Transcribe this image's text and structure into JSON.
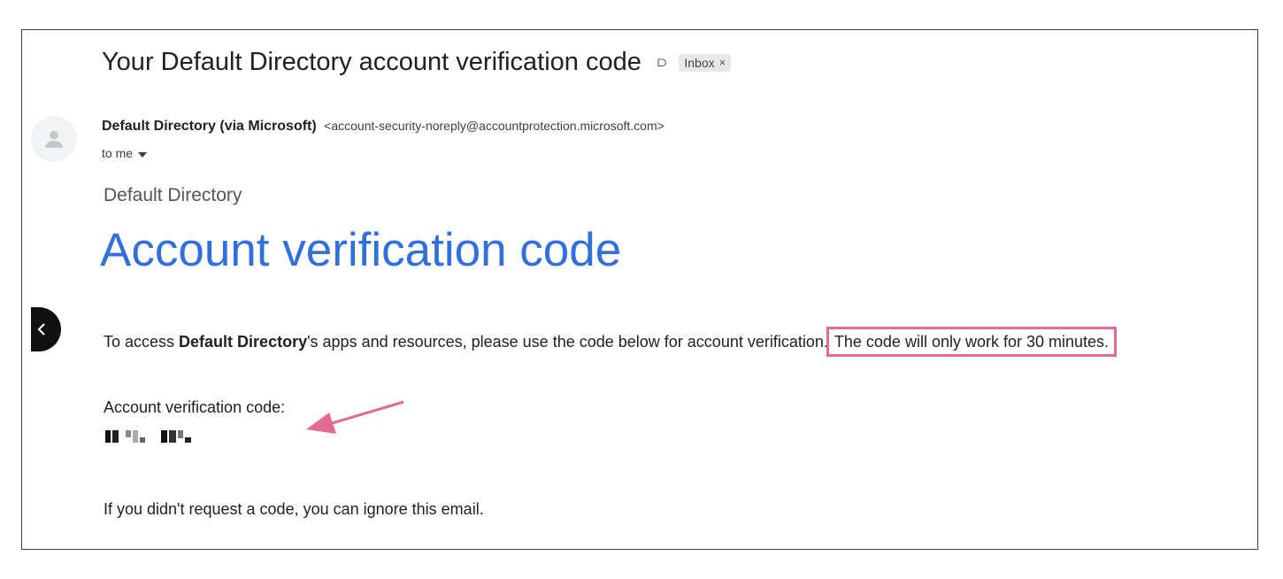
{
  "email": {
    "subject": "Your Default Directory account verification code",
    "label": "Inbox",
    "label_close": "×",
    "sender_name": "Default Directory (via Microsoft)",
    "sender_email": "<account-security-noreply@accountprotection.microsoft.com>",
    "to_line": "to me"
  },
  "body": {
    "org_name": "Default Directory",
    "heading": "Account verification code",
    "para_prefix": "To access ",
    "para_bold": "Default Directory",
    "para_suffix": "'s apps and resources, please use the code below for account verification.",
    "para_highlight": "The code will only work for 30 minutes.",
    "code_label": "Account verification code:",
    "ignore_text": "If you didn't request a code, you can ignore this email."
  },
  "icons": {
    "important": "important-marker-icon",
    "avatar": "person-avatar-icon",
    "dropdown": "chevron-down-icon",
    "back": "chevron-left-icon",
    "annotation": "pink-arrow-annotation"
  },
  "colors": {
    "heading": "#2f6fde",
    "annotation": "#e46a93",
    "text": "#202124"
  }
}
